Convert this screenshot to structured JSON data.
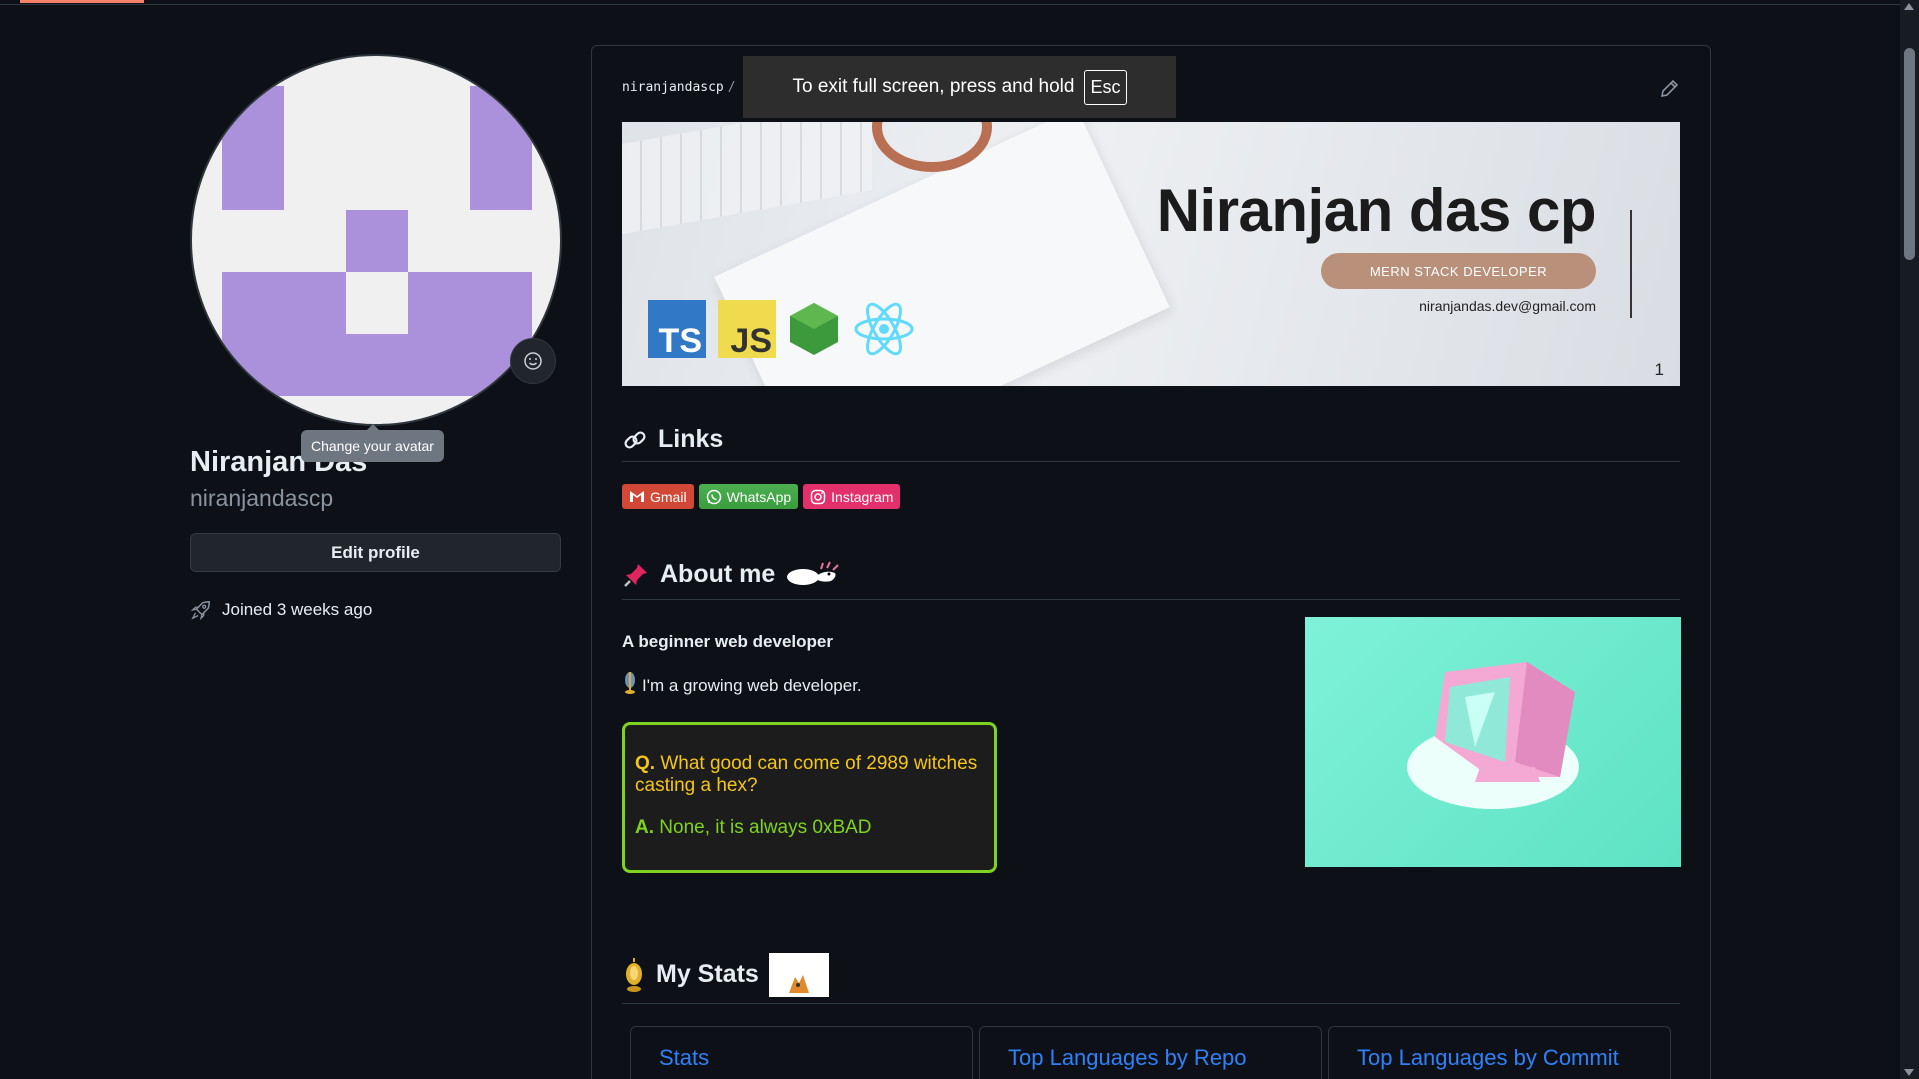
{
  "profile": {
    "tooltip": "Change your avatar",
    "fullname": "Niranjan Das",
    "username": "niranjandascp",
    "edit_label": "Edit profile",
    "joined": "Joined 3 weeks ago"
  },
  "fullscreen": {
    "message": "To exit full screen, press and hold",
    "key": "Esc"
  },
  "readme": {
    "repo_path": "niranjandascp",
    "banner": {
      "title": "Niranjan das cp",
      "role": "MERN STACK DEVELOPER",
      "email": "niranjandas.dev@gmail.com",
      "number": "1",
      "ts": "TS",
      "js": "JS"
    },
    "links_heading": "Links",
    "badges": [
      {
        "label": "Gmail",
        "color": "#d14836"
      },
      {
        "label": "WhatsApp",
        "color": "#4caf50"
      },
      {
        "label": "Instagram",
        "color": "#e1306c"
      }
    ],
    "about_heading": "About me",
    "about_sub": "A beginner web developer",
    "growing": "I'm a growing web developer.",
    "quote": {
      "q_prefix": "Q.",
      "q_text": "What good can come of 2989 witches casting a hex?",
      "a_prefix": "A.",
      "a_text": "None, it is always 0xBAD"
    },
    "stats_heading": "My Stats",
    "tabs": [
      "Stats",
      "Top Languages by Repo",
      "Top Languages by Commit"
    ]
  }
}
